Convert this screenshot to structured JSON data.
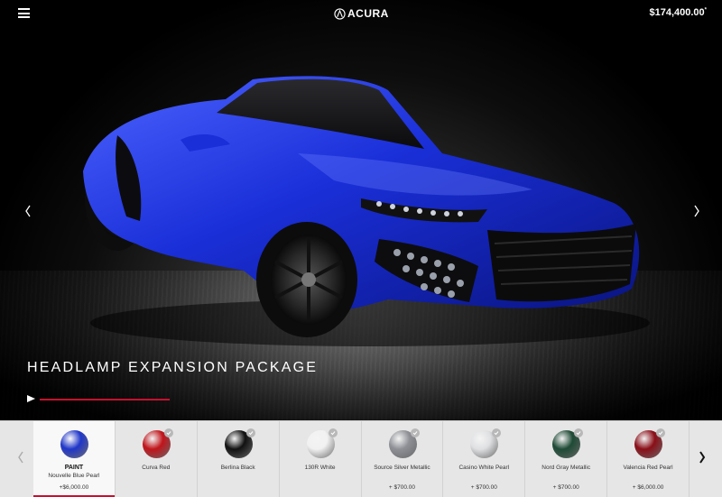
{
  "header": {
    "menu_icon": "hamburger-menu-icon",
    "brand": "ACURA",
    "price": "$174,400.00",
    "price_mark": "*"
  },
  "hero": {
    "package_title": "HEADLAMP EXPANSION PACKAGE",
    "car_color": "#1a2fd8",
    "accent_color": "#c8102e"
  },
  "swatches": [
    {
      "category": "PAINT",
      "name": "Nouvelle Blue Pearl",
      "price": "+$6,000.00",
      "color": "#1f36c9",
      "selected": true
    },
    {
      "name": "Curva Red",
      "price": "",
      "color": "#c0151b"
    },
    {
      "name": "Berlina Black",
      "price": "",
      "color": "#111111"
    },
    {
      "name": "130R White",
      "price": "",
      "color": "#f1f1f1"
    },
    {
      "name": "Source Silver Metallic",
      "price": "+ $700.00",
      "color": "#8e9096"
    },
    {
      "name": "Casino White Pearl",
      "price": "+ $700.00",
      "color": "#dfe0e2"
    },
    {
      "name": "Nord Gray Metallic",
      "price": "+ $700.00",
      "color": "#1e4a35"
    },
    {
      "name": "Valencia Red Pearl",
      "price": "+ $6,000.00",
      "color": "#8a0f18"
    }
  ]
}
